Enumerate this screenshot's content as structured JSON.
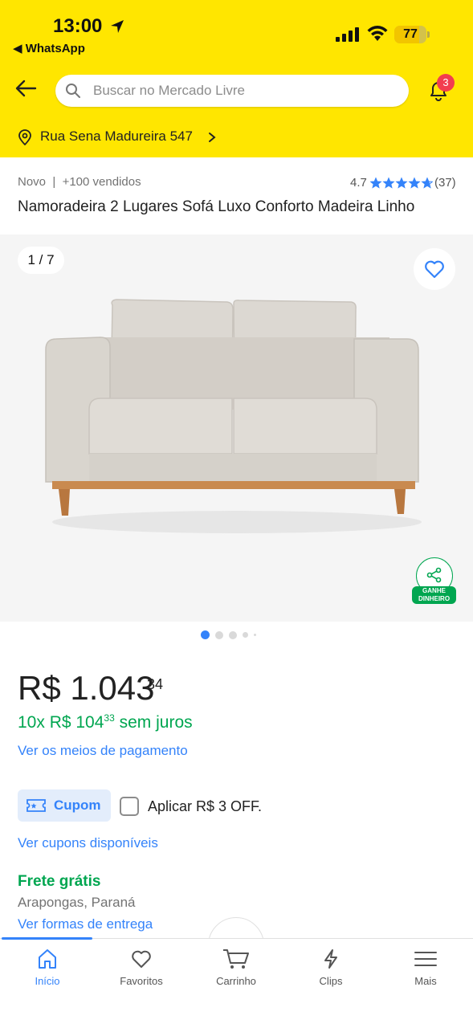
{
  "status_bar": {
    "time": "13:00",
    "back_app": "◀ WhatsApp",
    "battery": "77",
    "battery_level": 0.77
  },
  "header": {
    "search_placeholder": "Buscar no Mercado Livre",
    "notification_count": "3",
    "address": "Rua Sena Madureira 547",
    "brand_color": "#FFE600"
  },
  "product": {
    "condition": "Novo  |  +100 vendidos",
    "rating": "4.7",
    "rating_count": "(37)",
    "stars": 4.7,
    "title": "Namoradeira 2 Lugares Sofá Luxo Conforto Madeira Linho",
    "image_counter": "1 / 7",
    "share_label_1": "GANHE",
    "share_label_2": "DINHEIRO",
    "images_total": 5,
    "images_active": 1
  },
  "price": {
    "main": "R$ 1.043",
    "cents": "34",
    "installments_prefix": "10x R$ 104",
    "installments_cents": "33",
    "installments_suffix": " sem juros",
    "payment_link": "Ver os meios de pagamento"
  },
  "coupon": {
    "button_label": "Cupom",
    "apply_text": "Aplicar R$ 3 OFF.",
    "link": "Ver cupons disponíveis"
  },
  "shipping": {
    "title": "Frete grátis",
    "origin": "Arapongas, Paraná",
    "link": "Ver formas de entrega"
  },
  "tabbar": {
    "items": [
      {
        "label": "Início",
        "icon": "home-icon",
        "active": true
      },
      {
        "label": "Favoritos",
        "icon": "heart-icon"
      },
      {
        "label": "Carrinho",
        "icon": "cart-icon"
      },
      {
        "label": "Clips",
        "icon": "clips-icon"
      },
      {
        "label": "Mais",
        "icon": "menu-icon"
      }
    ]
  },
  "colors": {
    "accent": "#3483fa",
    "green": "#00a650",
    "badge": "#f23d4f"
  }
}
